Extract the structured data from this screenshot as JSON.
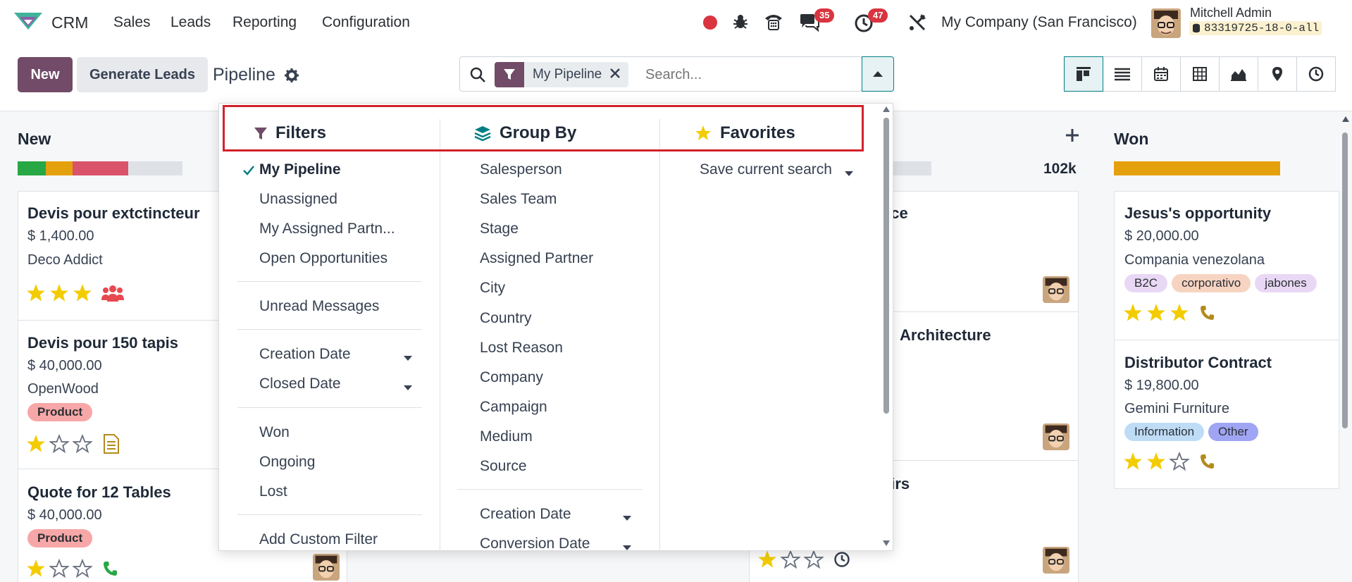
{
  "nav": {
    "app": "CRM",
    "menus": [
      "Sales",
      "Leads",
      "Reporting",
      "Configuration"
    ],
    "chat_count": "35",
    "activity_count": "47",
    "company": "My Company (San Francisco)",
    "user": "Mitchell Admin",
    "db": "83319725-18-0-all"
  },
  "cp": {
    "new_label": "New",
    "generate_label": "Generate Leads",
    "breadcrumb": "Pipeline",
    "facet": "My Pipeline",
    "search_placeholder": "Search..."
  },
  "dropdown": {
    "filters_title": "Filters",
    "groupby_title": "Group By",
    "favorites_title": "Favorites",
    "filters": [
      "My Pipeline",
      "Unassigned",
      "My Assigned Partn...",
      "Open Opportunities",
      "Unread Messages",
      "Creation Date",
      "Closed Date",
      "Won",
      "Ongoing",
      "Lost",
      "Add Custom Filter"
    ],
    "groupby": [
      "Salesperson",
      "Sales Team",
      "Stage",
      "Assigned Partner",
      "City",
      "Country",
      "Lost Reason",
      "Company",
      "Campaign",
      "Medium",
      "Source",
      "Creation Date",
      "Conversion Date"
    ],
    "save_search": "Save current search"
  },
  "kanban": {
    "col_new": "New",
    "col_won": "Won",
    "total_mid": "102k",
    "new_cards": [
      {
        "title": "Devis pour extctincteur",
        "amount": "$ 1,400.00",
        "partner": "Deco Addict"
      },
      {
        "title": "Devis pour 150 tapis",
        "amount": "$ 40,000.00",
        "partner": "OpenWood",
        "tag": "Product"
      },
      {
        "title": "Quote for 12 Tables",
        "amount": "$ 40,000.00",
        "tag": "Product"
      }
    ],
    "mid_cards": [
      {
        "title": "ace"
      },
      {
        "title": "Architecture"
      },
      {
        "title": "airs"
      }
    ],
    "won_cards": [
      {
        "title": "Jesus's opportunity",
        "amount": "$ 20,000.00",
        "partner": "Compania venezolana",
        "tags": [
          "B2C",
          "corporativo",
          "jabones"
        ]
      },
      {
        "title": "Distributor Contract",
        "amount": "$ 19,800.00",
        "partner": "Gemini Furniture",
        "tags": [
          "Information",
          "Other"
        ]
      }
    ]
  },
  "colors": {
    "primary": "#714b67",
    "teal": "#017e84",
    "badge": "#d9343f",
    "star": "#f3cc00",
    "highlight": "#d2222d"
  }
}
